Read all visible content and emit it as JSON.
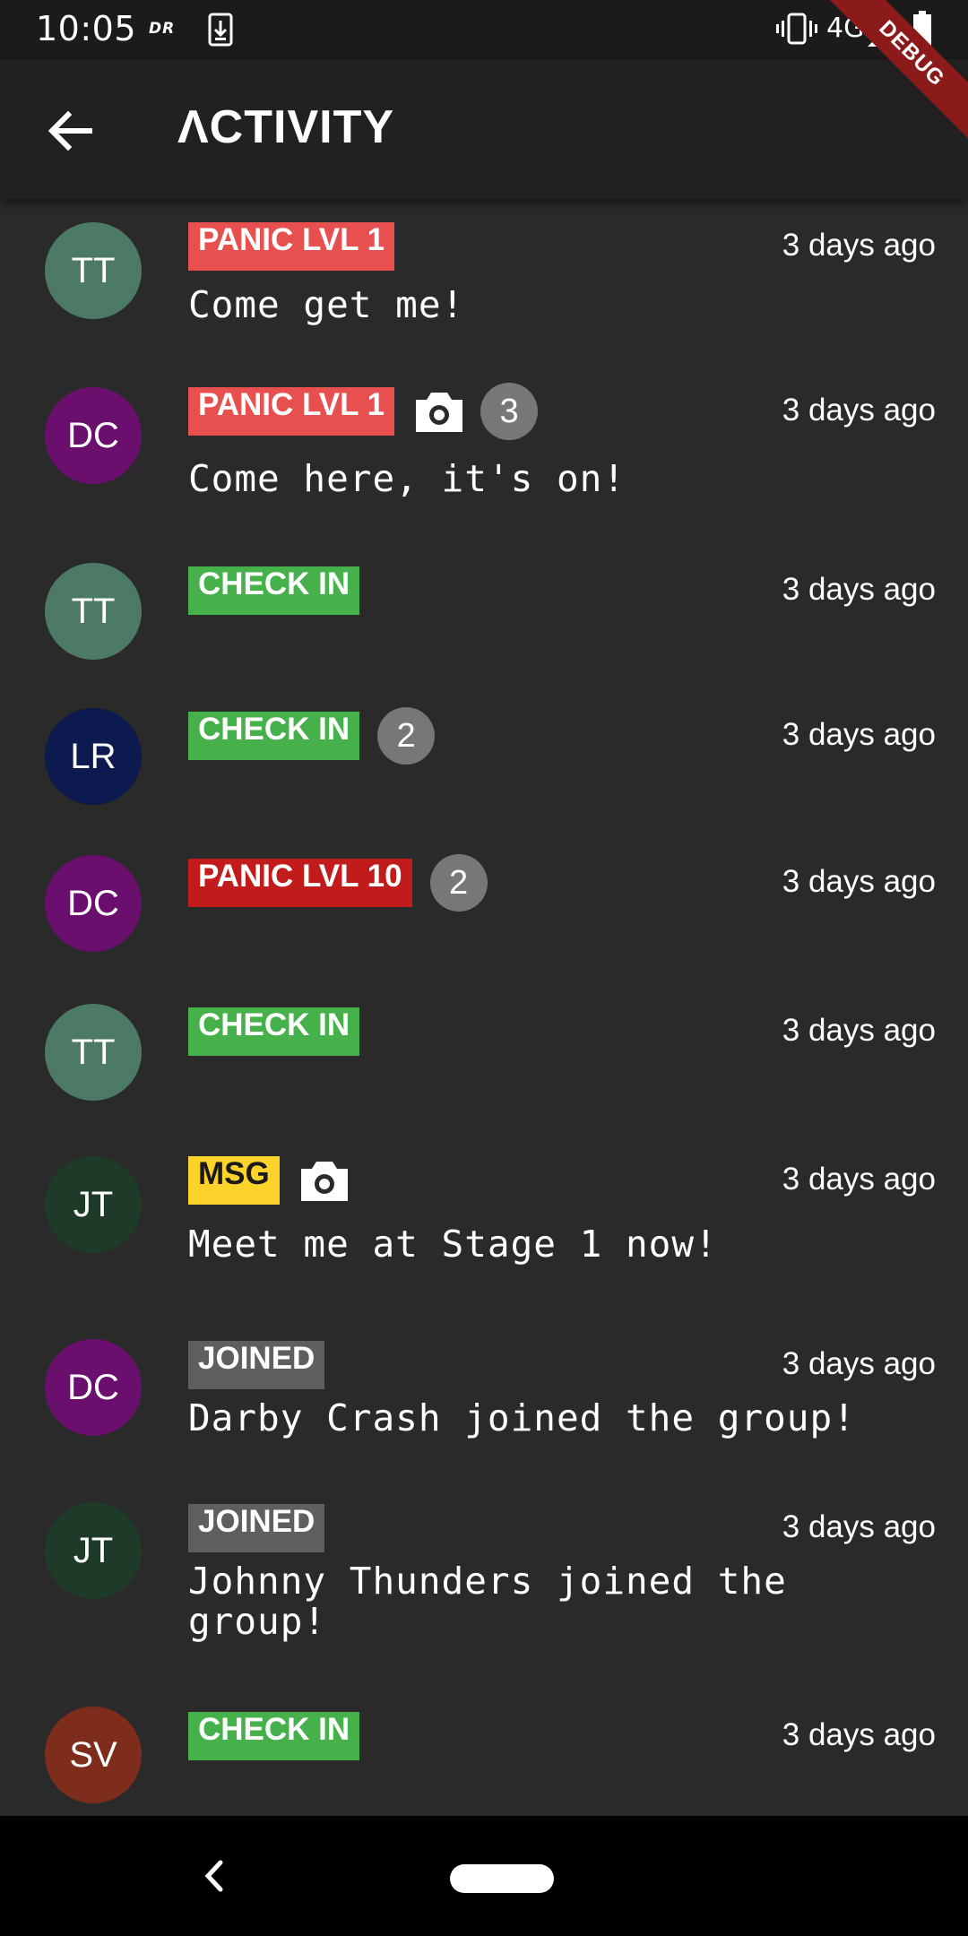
{
  "status_bar": {
    "time": "10:05",
    "carrier_logo": "DR",
    "network": "4G"
  },
  "debug_banner": "DEBUG",
  "app_bar": {
    "title": "ΛCTIVITY",
    "back_icon": "arrow-left-icon"
  },
  "colors": {
    "panic": "#e84f4f",
    "panic_high": "#c11b1b",
    "check_in": "#46b04a",
    "msg": "#fbd32a",
    "joined": "#5f5f5f"
  },
  "activities": [
    {
      "initials": "TT",
      "avatar_color": "#4d7a64",
      "tag": "PANIC LVL 1",
      "tag_type": "panic",
      "photo": false,
      "count": "",
      "time": "3 days ago",
      "message": "Come get me!"
    },
    {
      "initials": "DC",
      "avatar_color": "#6b0f6f",
      "tag": "PANIC LVL 1",
      "tag_type": "panic",
      "photo": true,
      "count": "3",
      "time": "3 days ago",
      "message": "Come here, it's on!"
    },
    {
      "initials": "TT",
      "avatar_color": "#4d7a64",
      "tag": "CHECK IN",
      "tag_type": "checkin",
      "photo": false,
      "count": "",
      "time": "3 days ago",
      "message": ""
    },
    {
      "initials": "LR",
      "avatar_color": "#0c1a4f",
      "tag": "CHECK IN",
      "tag_type": "checkin",
      "photo": false,
      "count": "2",
      "time": "3 days ago",
      "message": ""
    },
    {
      "initials": "DC",
      "avatar_color": "#6b0f6f",
      "tag": "PANIC LVL 10",
      "tag_type": "panic10",
      "photo": false,
      "count": "2",
      "time": "3 days ago",
      "message": ""
    },
    {
      "initials": "TT",
      "avatar_color": "#4d7a64",
      "tag": "CHECK IN",
      "tag_type": "checkin",
      "photo": false,
      "count": "",
      "time": "3 days ago",
      "message": ""
    },
    {
      "initials": "JT",
      "avatar_color": "#1e3a28",
      "tag": "MSG",
      "tag_type": "msg",
      "photo": true,
      "count": "",
      "time": "3 days ago",
      "message": "Meet me at Stage 1 now!"
    },
    {
      "initials": "DC",
      "avatar_color": "#6b0f6f",
      "tag": "JOINED",
      "tag_type": "joined",
      "photo": false,
      "count": "",
      "time": "3 days ago",
      "message": "Darby Crash joined the group!"
    },
    {
      "initials": "JT",
      "avatar_color": "#1e3a28",
      "tag": "JOINED",
      "tag_type": "joined",
      "photo": false,
      "count": "",
      "time": "3 days ago",
      "message": "Johnny Thunders joined the group!"
    },
    {
      "initials": "SV",
      "avatar_color": "#7e2c1c",
      "tag": "CHECK IN",
      "tag_type": "checkin",
      "photo": false,
      "count": "",
      "time": "3 days ago",
      "message": ""
    }
  ]
}
